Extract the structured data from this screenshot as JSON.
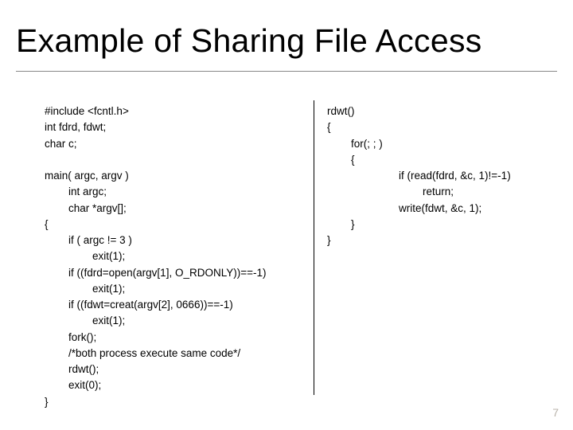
{
  "title": "Example of Sharing File Access",
  "code_left": "#include <fcntl.h>\nint fdrd, fdwt;\nchar c;\n\nmain( argc, argv )\n        int argc;\n        char *argv[];\n{\n        if ( argc != 3 )\n                exit(1);\n        if ((fdrd=open(argv[1], O_RDONLY))==-1)\n                exit(1);\n        if ((fdwt=creat(argv[2], 0666))==-1)\n                exit(1);\n        fork();\n        /*both process execute same code*/\n        rdwt();\n        exit(0);\n}",
  "code_right": "rdwt()\n{\n        for(; ; )\n        {\n                        if (read(fdrd, &c, 1)!=-1)\n                                return;\n                        write(fdwt, &c, 1);\n        }\n}",
  "page_number": "7"
}
